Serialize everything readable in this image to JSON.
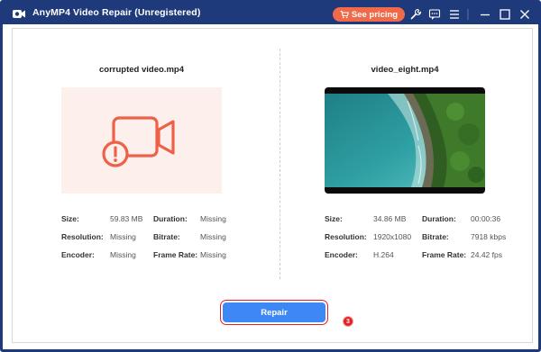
{
  "window": {
    "title": "AnyMP4 Video Repair (Unregistered)",
    "see_pricing_label": "See pricing"
  },
  "left_panel": {
    "file_name": "corrupted video.mp4",
    "info": [
      {
        "label": "Size:",
        "value": "59.83 MB"
      },
      {
        "label": "Duration:",
        "value": "Missing"
      },
      {
        "label": "Resolution:",
        "value": "Missing"
      },
      {
        "label": "Bitrate:",
        "value": "Missing"
      },
      {
        "label": "Encoder:",
        "value": "Missing"
      },
      {
        "label": "Frame Rate:",
        "value": "Missing"
      }
    ]
  },
  "right_panel": {
    "file_name": "video_eight.mp4",
    "info": [
      {
        "label": "Size:",
        "value": "34.86 MB"
      },
      {
        "label": "Duration:",
        "value": "00:00:36"
      },
      {
        "label": "Resolution:",
        "value": "1920x1080"
      },
      {
        "label": "Bitrate:",
        "value": "7918 kbps"
      },
      {
        "label": "Encoder:",
        "value": "H.264"
      },
      {
        "label": "Frame Rate:",
        "value": "24.42 fps"
      }
    ]
  },
  "actions": {
    "repair_label": "Repair",
    "step_number": "3"
  },
  "colors": {
    "titlebar": "#1f3a7a",
    "accent_orange": "#f06a4a",
    "repair_blue": "#3e88f6",
    "highlight_red": "#e62020"
  },
  "icons": {
    "app_logo": "camera-logo-icon",
    "pricing": "cart-icon",
    "tools": "wrench-icon",
    "feedback": "chat-icon",
    "menu": "menu-icon",
    "minimize": "minimize-icon",
    "maximize": "maximize-icon",
    "close": "close-icon",
    "broken_video": "broken-video-camera-icon"
  }
}
